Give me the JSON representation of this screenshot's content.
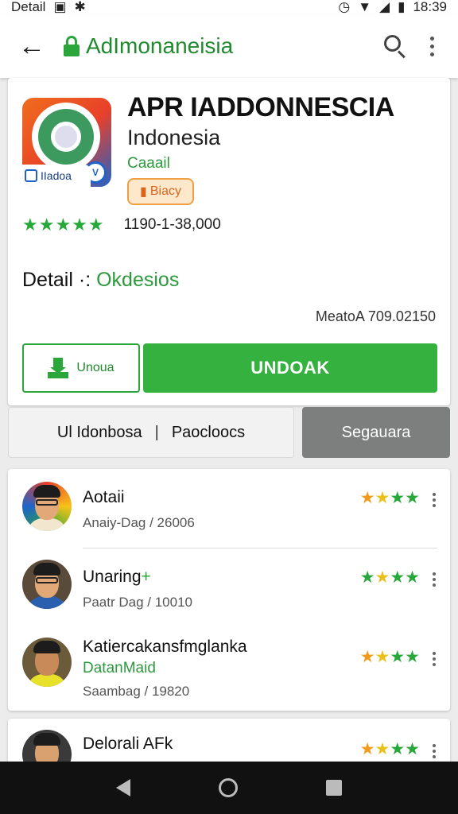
{
  "status_bar": {
    "left_text": "Detail",
    "time": "18:39",
    "icons": [
      "image-icon",
      "bluetooth-icon",
      "alarm-icon",
      "wifi-icon",
      "signal-icon",
      "battery-icon"
    ]
  },
  "app_bar": {
    "title": "AdImonaneisia",
    "actions": [
      "search-icon",
      "more-vert-icon"
    ]
  },
  "app": {
    "name": "APR IADDONNESCIA",
    "subtitle": "Indonesia",
    "developer": "Caaail",
    "badge": "Biacy",
    "icon_tag": "IIadoa",
    "rating_stars": 5,
    "downloads": "1190-1-38,000",
    "detail_label": "Detail",
    "detail_separator": "·:",
    "detail_value": "Okdesios",
    "version": "MeatoA 709.02150"
  },
  "buttons": {
    "secondary_label": "Unoua",
    "primary_label": "UNDOAK"
  },
  "tabs": {
    "tab1": "Ul Idonbosa",
    "separator": "|",
    "tab2": "Paocloocs",
    "tab3_active": "Segauara"
  },
  "reviews": [
    {
      "name": "Aotaii",
      "plus": "",
      "extra": "",
      "meta": "Anaiy-Dag / 26006",
      "stars": [
        "o",
        "y",
        "g",
        "g"
      ]
    },
    {
      "name": "Unaring",
      "plus": "+",
      "extra": "",
      "meta": "Paatr Dag / 10010",
      "stars": [
        "g",
        "y",
        "g",
        "g"
      ]
    },
    {
      "name": "Katiercakansfmglanka",
      "plus": "",
      "extra": "DatanMaid",
      "meta": "Saambag / 19820",
      "stars": [
        "o",
        "y",
        "g",
        "g"
      ]
    },
    {
      "name": "Delorali AFk",
      "plus": "",
      "extra": "",
      "meta": "",
      "stars": [
        "o",
        "y",
        "g",
        "g"
      ]
    }
  ],
  "colors": {
    "accent_green": "#34b13f",
    "active_tab_gray": "#7d7f7f",
    "badge_orange": "#d9651b"
  }
}
